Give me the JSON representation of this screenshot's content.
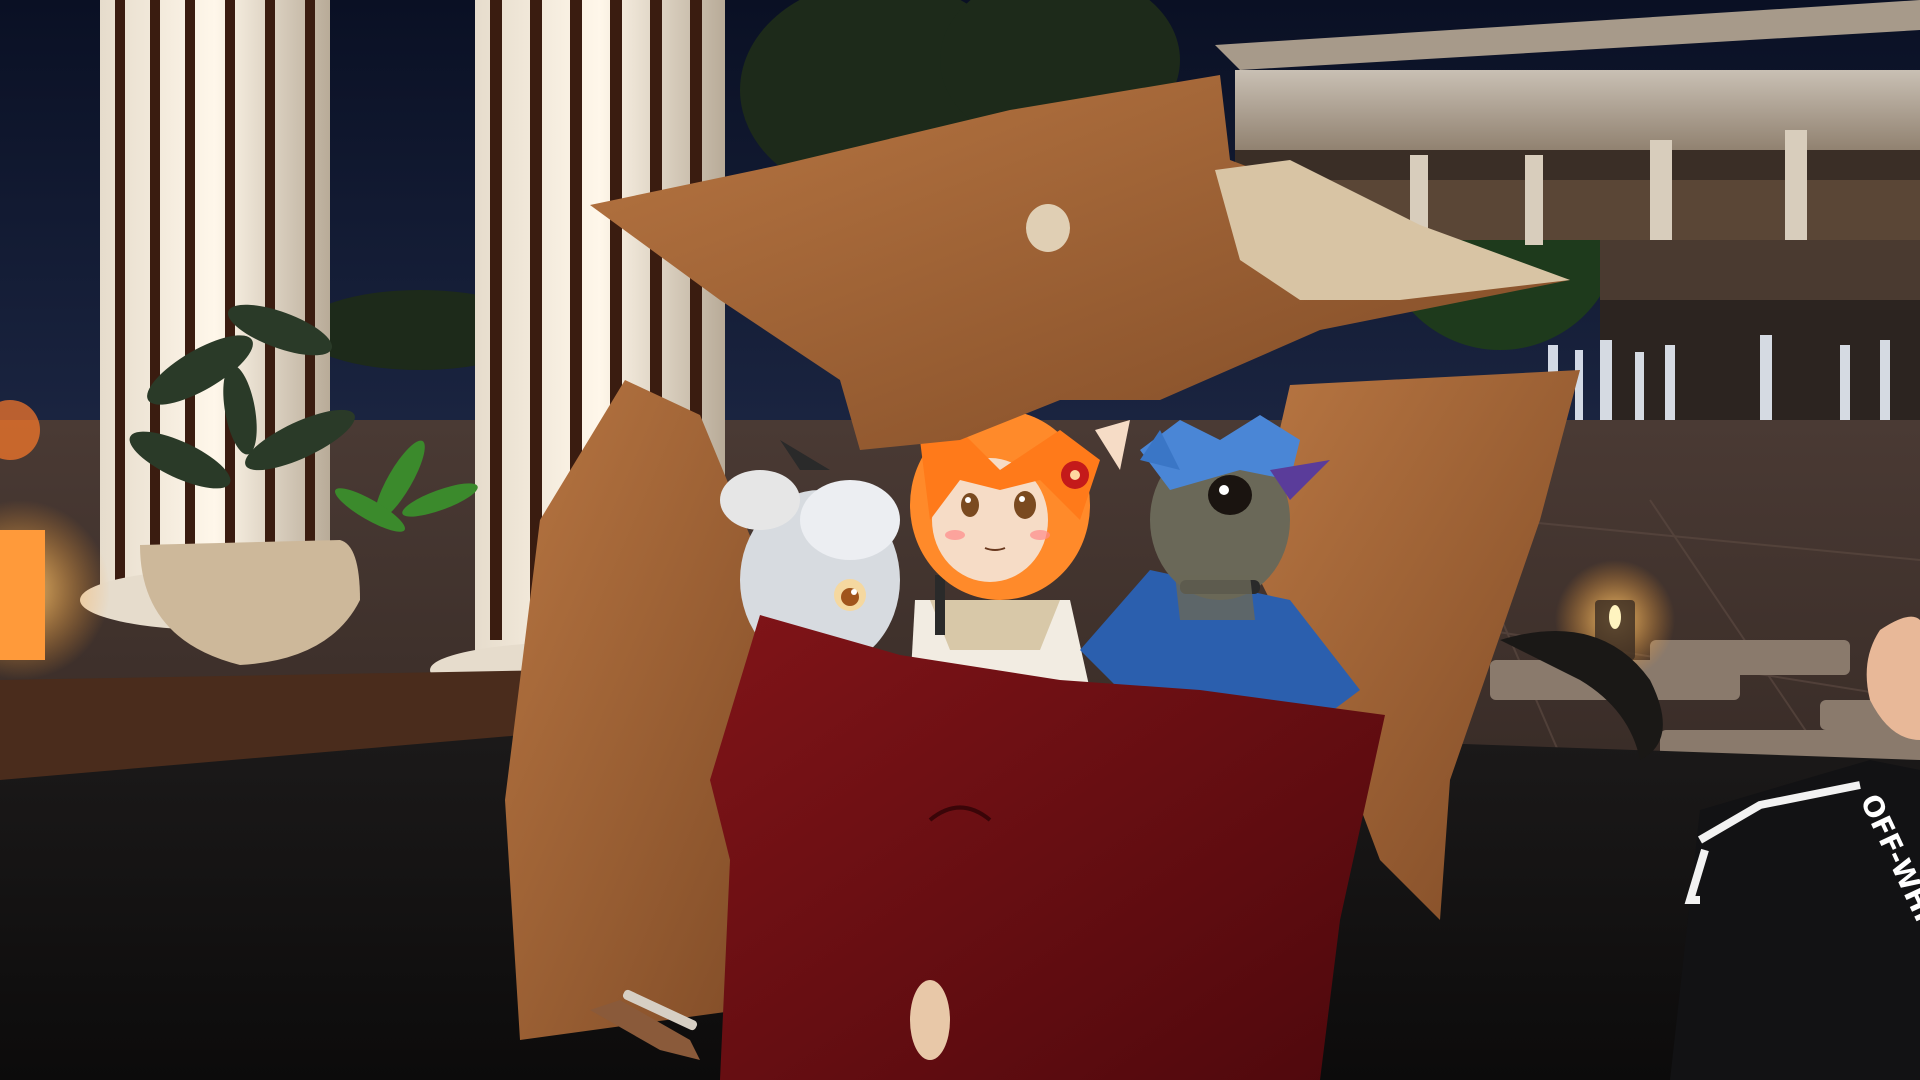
{
  "scene": {
    "type": "vr-social-world-night-courtyard",
    "characters": [
      "white-furry-avatar",
      "orange-fox-girl-avatar",
      "blue-dragon-avatar"
    ],
    "props": [
      "tan-pillow-top",
      "tan-pillow-left",
      "tan-pillow-right",
      "red-pillow-front",
      "white-columns",
      "potted-plants",
      "water-fountains",
      "candle-lantern"
    ]
  },
  "hud": {
    "sleeve_text": "OFF-WHITE"
  },
  "colors": {
    "sky": "#0e1630",
    "pillow_tan": "#a8683a",
    "pillow_red": "#6b0d12",
    "fox_hair": "#ff8a2a",
    "dragon_blue": "#2b5fae",
    "fountain_water": "#e8eef8",
    "warm_light": "#ffb04a"
  }
}
